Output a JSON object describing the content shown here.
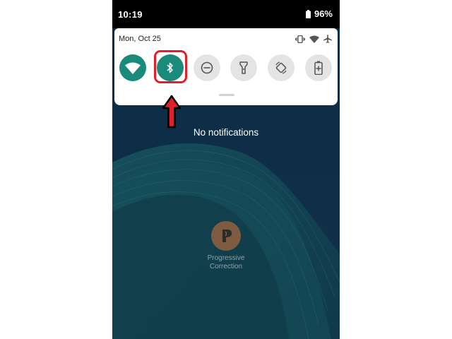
{
  "status_bar": {
    "time": "10:19",
    "battery_percent": "96%"
  },
  "quick_settings": {
    "date": "Mon, Oct 25",
    "status_icons": [
      "vibrate-icon",
      "wifi-signal-icon",
      "airplane-icon"
    ],
    "tiles": [
      {
        "name": "wifi",
        "icon": "wifi-icon",
        "active": true
      },
      {
        "name": "bluetooth",
        "icon": "bluetooth-icon",
        "active": true,
        "highlighted": true
      },
      {
        "name": "do-not-disturb",
        "icon": "minus-circle-icon",
        "active": false
      },
      {
        "name": "flashlight",
        "icon": "flashlight-icon",
        "active": false
      },
      {
        "name": "auto-rotate",
        "icon": "rotate-icon",
        "active": false
      },
      {
        "name": "battery-saver",
        "icon": "battery-plus-icon",
        "active": false
      }
    ]
  },
  "notifications": {
    "empty_text": "No notifications"
  },
  "watermark": {
    "text_line1": "Progressive",
    "text_line2": "Correction"
  },
  "colors": {
    "accent": "#1a8a7a",
    "highlight": "#e0202a",
    "wallpaper": "#0e2c44"
  }
}
